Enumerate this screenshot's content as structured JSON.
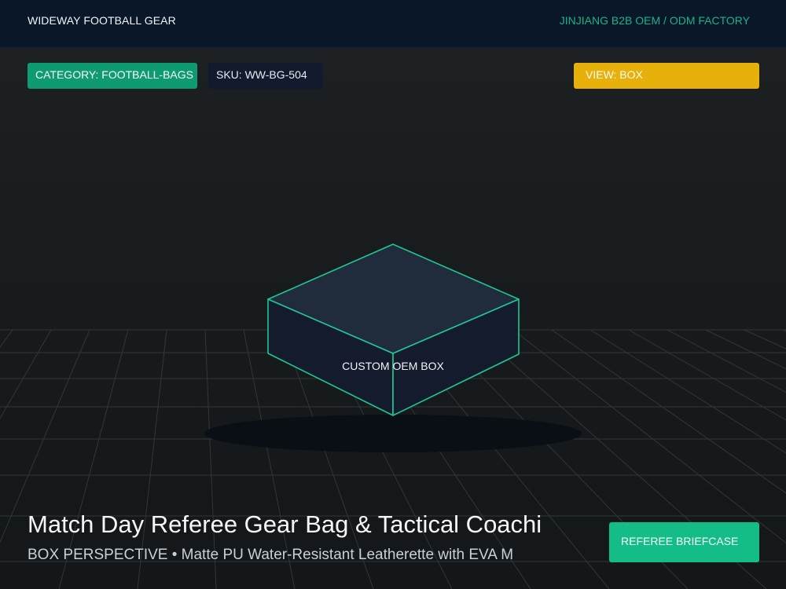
{
  "header": {
    "brand": "WIDEWAY FOOTBALL GEAR",
    "factory": "JINJIANG B2B OEM / ODM FACTORY"
  },
  "chips": {
    "category": "CATEGORY: FOOTBALL-BAGS",
    "sku": "SKU: WW-BG-504",
    "view": "VIEW: BOX"
  },
  "preview": {
    "box_label": "CUSTOM OEM BOX"
  },
  "product": {
    "title": "Match Day Referee Gear Bag & Tactical Coachi",
    "subtitle": "BOX PERSPECTIVE • Matte PU Water-Resistant Leatherette with EVA M",
    "cta_label": "REFEREE BRIEFCASE"
  },
  "colors": {
    "header_bg": "#091729",
    "accent_green": "#0f9b72",
    "accent_yellow": "#e8b00b",
    "box_edge": "#1fc794",
    "cta_bg": "#14bd88"
  }
}
